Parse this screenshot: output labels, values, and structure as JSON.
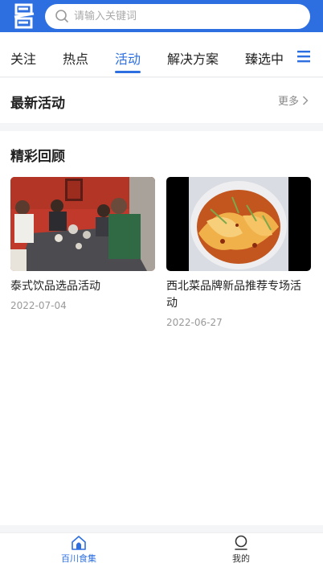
{
  "search": {
    "placeholder": "请输入关键词"
  },
  "tabs": [
    {
      "label": "关注"
    },
    {
      "label": "热点"
    },
    {
      "label": "活动"
    },
    {
      "label": "解决方案"
    },
    {
      "label": "臻选中"
    }
  ],
  "active_tab": "活动",
  "latest": {
    "title": "最新活动",
    "more": "更多"
  },
  "review": {
    "title": "精彩回顾",
    "cards": [
      {
        "title": "泰式饮品选品活动",
        "date": "2022-07-04"
      },
      {
        "title": "西北菜品牌新品推荐专场活动",
        "date": "2022-06-27"
      }
    ]
  },
  "bottom_nav": [
    {
      "label": "百川食集"
    },
    {
      "label": "我的"
    }
  ],
  "colors": {
    "accent": "#2d6fe0"
  }
}
